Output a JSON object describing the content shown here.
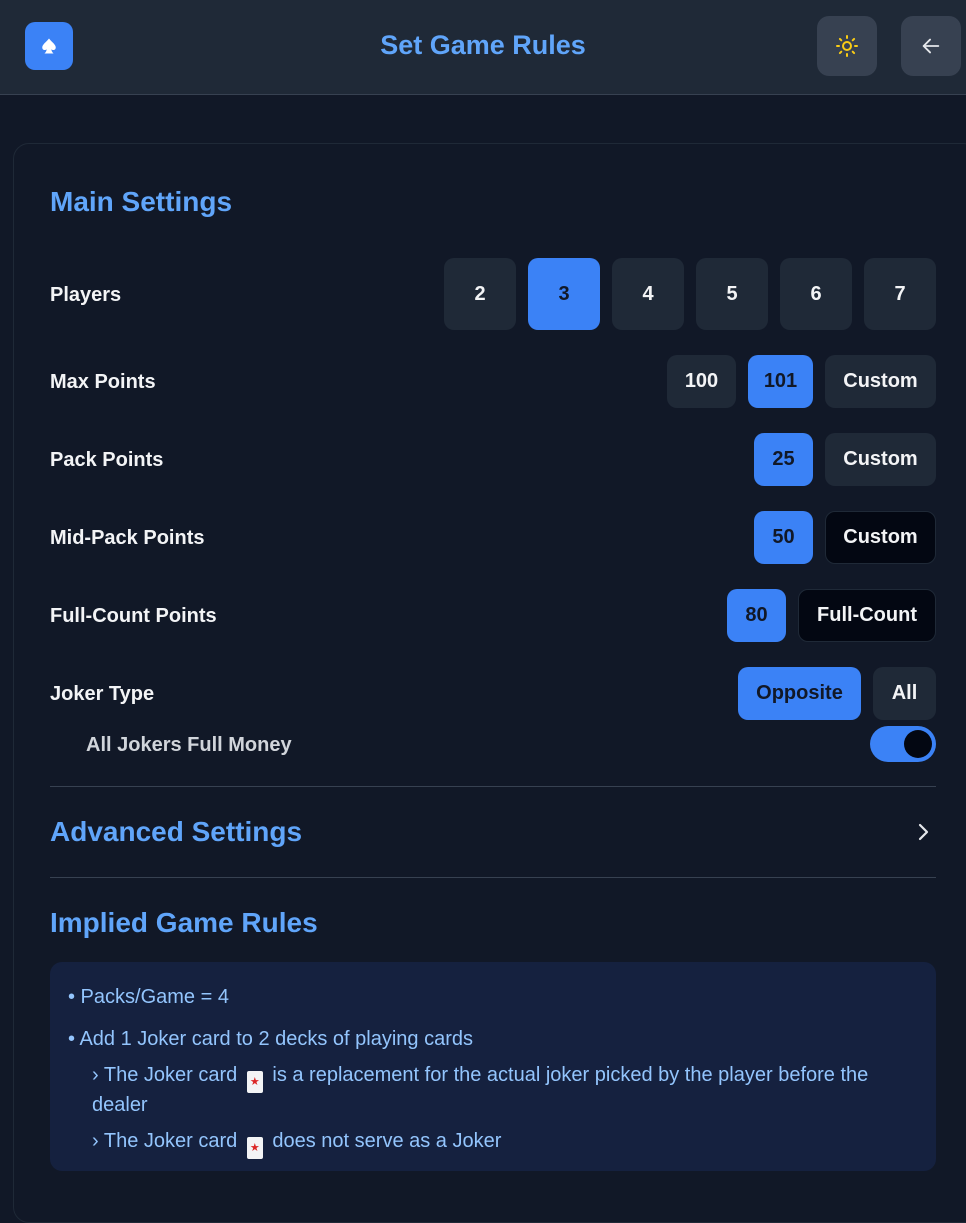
{
  "header": {
    "title": "Set Game Rules",
    "logo_icon": "spade-icon",
    "theme_icon": "sun-icon",
    "back_icon": "arrow-left-icon"
  },
  "main_settings": {
    "title": "Main Settings",
    "players": {
      "label": "Players",
      "options": [
        "2",
        "3",
        "4",
        "5",
        "6",
        "7"
      ],
      "selected": "3"
    },
    "max_points": {
      "label": "Max Points",
      "options": [
        "100",
        "101",
        "Custom"
      ],
      "selected": "101"
    },
    "pack_points": {
      "label": "Pack Points",
      "options": [
        "25",
        "Custom"
      ],
      "selected": "25"
    },
    "mid_pack_points": {
      "label": "Mid-Pack Points",
      "options": [
        "50",
        "Custom"
      ],
      "selected": "50"
    },
    "full_count_points": {
      "label": "Full-Count Points",
      "options": [
        "80",
        "Full-Count"
      ],
      "selected": "80"
    },
    "joker_type": {
      "label": "Joker Type",
      "options": [
        "Opposite",
        "All"
      ],
      "selected": "Opposite"
    },
    "all_jokers_full_money": {
      "label": "All Jokers Full Money",
      "enabled": true
    }
  },
  "advanced_settings": {
    "title": "Advanced Settings"
  },
  "implied_rules": {
    "title": "Implied Game Rules",
    "items": [
      "• Packs/Game = 4",
      "• Add 1 Joker card to 2 decks of playing cards"
    ],
    "sub_items": [
      {
        "prefix": "› The Joker card",
        "suffix": "is a replacement for the actual joker picked by the player before the",
        "continuation": "dealer"
      },
      {
        "prefix": "› The Joker card",
        "suffix": "does not serve as a Joker"
      }
    ]
  },
  "colors": {
    "accent": "#3b82f6",
    "background": "#111827",
    "header_bg": "#1f2937"
  }
}
